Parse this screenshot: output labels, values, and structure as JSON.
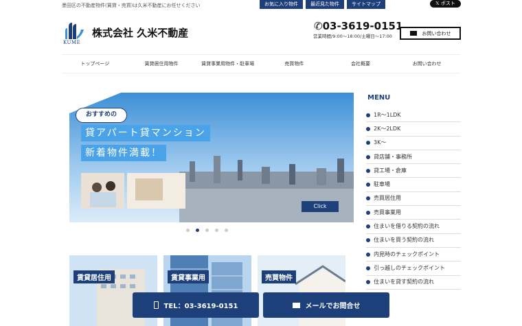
{
  "header": {
    "tagline": "墨田区の不動産物件(賃貸・売買)は久米不動産にお任せください",
    "top_links": [
      "お気に入り物件",
      "最近見た物件",
      "サイトマップ"
    ],
    "x_post": "ポスト",
    "logo_text": "KUME",
    "company": "株式会社 久米不動産",
    "phone": "03-3619-0151",
    "hours": "営業時間/9:00～18:00/土曜日～17:00",
    "contact_label": "お問い合わせ"
  },
  "nav": [
    "トップページ",
    "賃貸居住用物件",
    "賃貸事業用物件・駐車場",
    "売買物件",
    "会社概要",
    "お問い合わせ"
  ],
  "hero": {
    "bubble": "おすすめの",
    "line1": "貸アパート貸マンション",
    "line2": "新着物件満載！",
    "click": "Click",
    "slide_count": 5,
    "active_slide": 2
  },
  "sidebar": {
    "title": "MENU",
    "items": [
      "1R～1LDK",
      "2K～2LDK",
      "3K～",
      "貸店舗・事務所",
      "貸工場・倉庫",
      "駐車場",
      "売買居住用",
      "売買事業用",
      "住まいを借りる契約の流れ",
      "住まいを買う契約の流れ",
      "内見時のチェックポイント",
      "引っ越しのチェックポイント",
      "住まいを貸す契約の流れ"
    ]
  },
  "cards": [
    "賃貸居住用",
    "賃貸事業用",
    "売買物件"
  ],
  "footer_bar": {
    "tel_label": "TEL：03-3619-0151",
    "mail_label": "メールでお問合せ"
  },
  "colors": {
    "brand": "#1d3f7a",
    "sky": "#3a8fd8"
  }
}
